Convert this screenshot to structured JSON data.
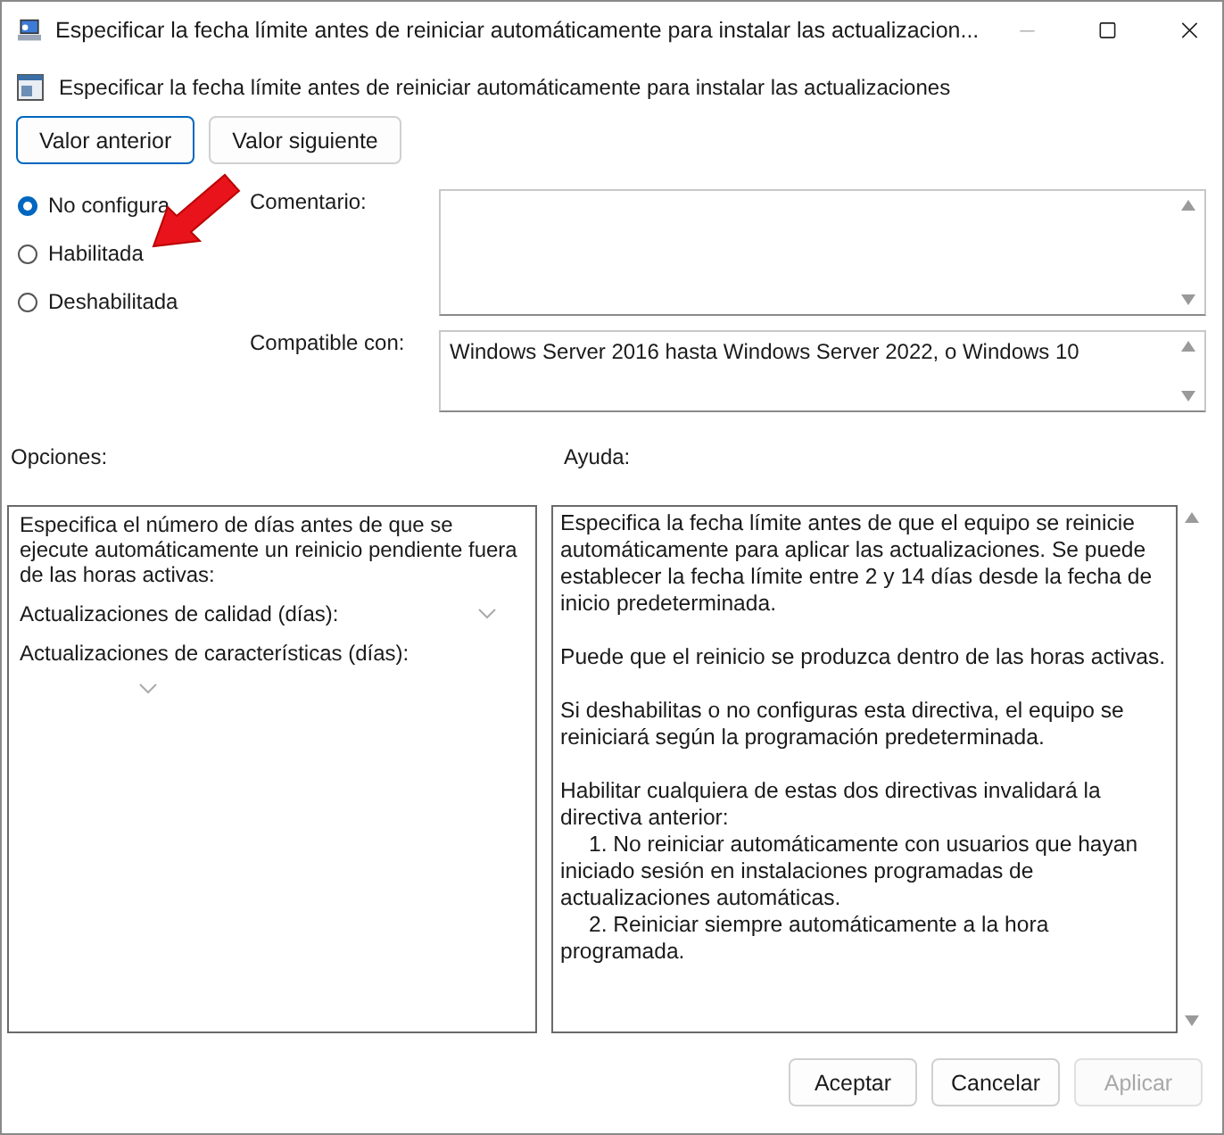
{
  "window": {
    "title": "Especificar la fecha límite antes de reiniciar automáticamente para instalar las actualizacion...",
    "minimize_disabled": true
  },
  "policy_title": "Especificar la fecha límite antes de reiniciar automáticamente para instalar las actualizaciones",
  "nav_buttons": [
    {
      "label": "Valor anterior",
      "selected": true
    },
    {
      "label": "Valor siguiente",
      "selected": false
    }
  ],
  "state_options": [
    {
      "label": "No configura",
      "selected": true
    },
    {
      "label": "Habilitada",
      "selected": false
    },
    {
      "label": "Deshabilitada",
      "selected": false
    }
  ],
  "comment": {
    "label": "Comentario:"
  },
  "supported_on": {
    "label": "Compatible con:",
    "value": "Windows Server 2016 hasta Windows Server 2022, o Windows 10"
  },
  "options": {
    "label": "Opciones:",
    "description": "Especifica el número de días antes de que se ejecute automáticamente un reinicio pendiente fuera de las horas activas:",
    "dropdowns": [
      {
        "label": "Actualizaciones de calidad (días):",
        "kind": "inline"
      },
      {
        "label": "Actualizaciones de características (días):",
        "kind": "below"
      }
    ]
  },
  "help": {
    "label": "Ayuda:",
    "paragraphs": [
      {
        "kind": "paragraph",
        "text": "Especifica la fecha límite antes de que el equipo se reinicie automáticamente para aplicar las actualizaciones. Se puede establecer la fecha límite entre 2 y 14 días desde la fecha de inicio predeterminada."
      },
      {
        "kind": "paragraph",
        "text": "Puede que el reinicio se produzca dentro de las horas activas."
      },
      {
        "kind": "paragraph",
        "text": "Si deshabilitas o no configuras esta directiva, el equipo se reiniciará según la programación predeterminada."
      },
      {
        "kind": "lead",
        "text": "Habilitar cualquiera de estas dos directivas invalidará la directiva anterior:"
      },
      {
        "kind": "item",
        "text": "1. No reiniciar automáticamente con usuarios que hayan iniciado sesión en instalaciones programadas de actualizaciones automáticas."
      },
      {
        "kind": "item",
        "text": "2. Reiniciar siempre automáticamente a la hora programada."
      }
    ]
  },
  "footer_buttons": [
    {
      "label": "Aceptar",
      "disabled": false
    },
    {
      "label": "Cancelar",
      "disabled": false
    },
    {
      "label": "Aplicar",
      "disabled": true
    }
  ]
}
